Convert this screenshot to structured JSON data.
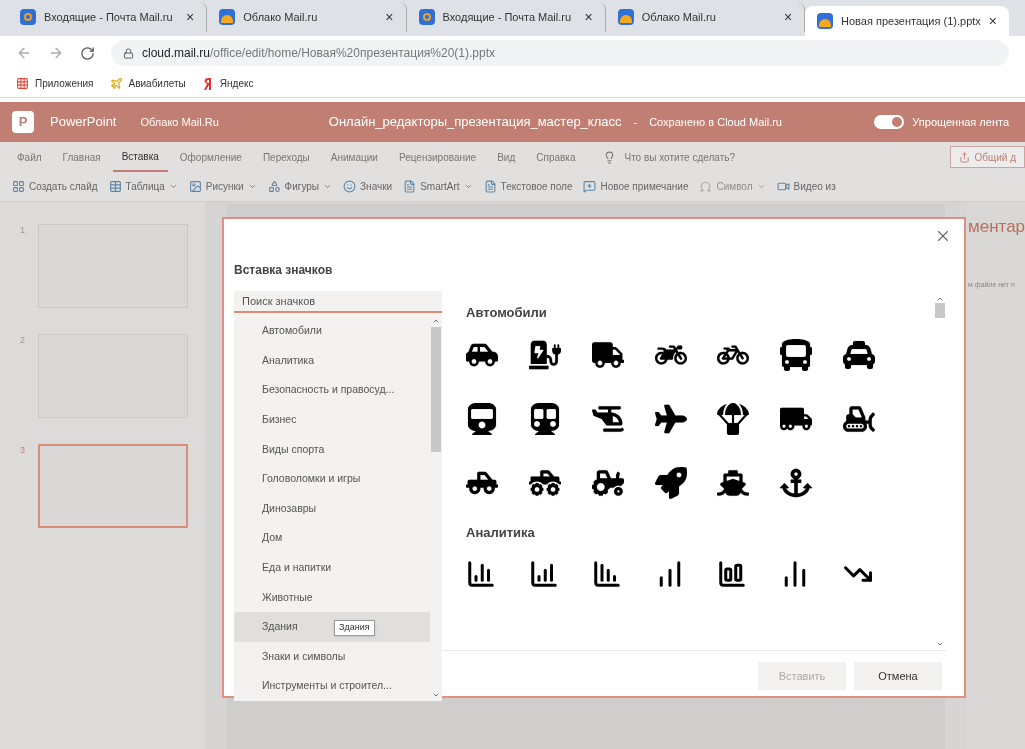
{
  "browser_tabs": [
    {
      "title": "Входящие - Почта Mail.ru",
      "kind": "mail",
      "selected": false
    },
    {
      "title": "Облако Mail.ru",
      "kind": "cloud",
      "selected": false
    },
    {
      "title": "Входящие - Почта Mail.ru",
      "kind": "mail",
      "selected": false
    },
    {
      "title": "Облако Mail.ru",
      "kind": "cloud",
      "selected": false
    },
    {
      "title": "Новая презентация (1).pptx",
      "kind": "cloud",
      "selected": true
    }
  ],
  "close_glyph": "×",
  "address": {
    "host": "cloud.mail.ru",
    "path": "/office/edit/home/Новая%20презентация%20(1).pptx"
  },
  "bookmarks": [
    {
      "label": "Приложения",
      "kind": "apps"
    },
    {
      "label": "Авиабилеты",
      "kind": "plane"
    },
    {
      "label": "Яндекс",
      "kind": "yandex"
    }
  ],
  "app_bar": {
    "logo": "P",
    "app": "PowerPoint",
    "service": "Облако Mail.Ru",
    "document": "Онлайн_редакторы_презентация_мастер_класс",
    "separator": "-",
    "status": "Сохранено в Cloud Mail.ru",
    "toggle_label": "Упрощенная лента",
    "toggle_on": true
  },
  "ribbon_tabs": [
    {
      "label": "Файл",
      "selected": false
    },
    {
      "label": "Главная",
      "selected": false
    },
    {
      "label": "Вставка",
      "selected": true
    },
    {
      "label": "Оформление",
      "selected": false
    },
    {
      "label": "Переходы",
      "selected": false
    },
    {
      "label": "Анимации",
      "selected": false
    },
    {
      "label": "Рецензирование",
      "selected": false
    },
    {
      "label": "Вид",
      "selected": false
    },
    {
      "label": "Справка",
      "selected": false
    }
  ],
  "tell_me": "Что вы хотите сделать?",
  "share": "Общий д",
  "toolbar": [
    {
      "label": "Создать слайд",
      "dropdown": false,
      "disabled": false
    },
    {
      "label": "Таблица",
      "dropdown": true,
      "disabled": false
    },
    {
      "label": "Рисунки",
      "dropdown": true,
      "disabled": false
    },
    {
      "label": "Фигуры",
      "dropdown": true,
      "disabled": false
    },
    {
      "label": "Значки",
      "dropdown": false,
      "disabled": false
    },
    {
      "label": "SmartArt",
      "dropdown": true,
      "disabled": false
    },
    {
      "label": "Текстовое поле",
      "dropdown": false,
      "disabled": false
    },
    {
      "label": "Новое примечание",
      "dropdown": false,
      "disabled": false
    },
    {
      "label": "Символ",
      "dropdown": true,
      "disabled": true
    },
    {
      "label": "Видео из",
      "dropdown": false,
      "disabled": false
    }
  ],
  "slides": [
    {
      "number": "1",
      "selected": false
    },
    {
      "number": "2",
      "selected": false
    },
    {
      "number": "3",
      "selected": true
    }
  ],
  "comments_pane": {
    "title": "ментар",
    "text": "м файле нет п"
  },
  "dialog": {
    "title": "Вставка значков",
    "search_placeholder": "Поиск значков",
    "categories": [
      {
        "label": "Автомобили",
        "highlighted": false
      },
      {
        "label": "Аналитика",
        "highlighted": false
      },
      {
        "label": "Безопасность и правосуд...",
        "highlighted": false
      },
      {
        "label": "Бизнес",
        "highlighted": false
      },
      {
        "label": "Виды спорта",
        "highlighted": false
      },
      {
        "label": "Головоломки и игры",
        "highlighted": false
      },
      {
        "label": "Динозавры",
        "highlighted": false
      },
      {
        "label": "Дом",
        "highlighted": false
      },
      {
        "label": "Еда и напитки",
        "highlighted": false
      },
      {
        "label": "Животные",
        "highlighted": false
      },
      {
        "label": "Здания",
        "highlighted": true
      },
      {
        "label": "Знаки и символы",
        "highlighted": false
      },
      {
        "label": "Инструменты и строител...",
        "highlighted": false
      }
    ],
    "tooltip": "Здания",
    "sections": [
      {
        "title": "Автомобили",
        "kind": "vehicles"
      },
      {
        "title": "Аналитика",
        "kind": "analytics"
      }
    ],
    "insert": {
      "label": "Вставить",
      "disabled": true
    },
    "cancel": "Отмена"
  }
}
